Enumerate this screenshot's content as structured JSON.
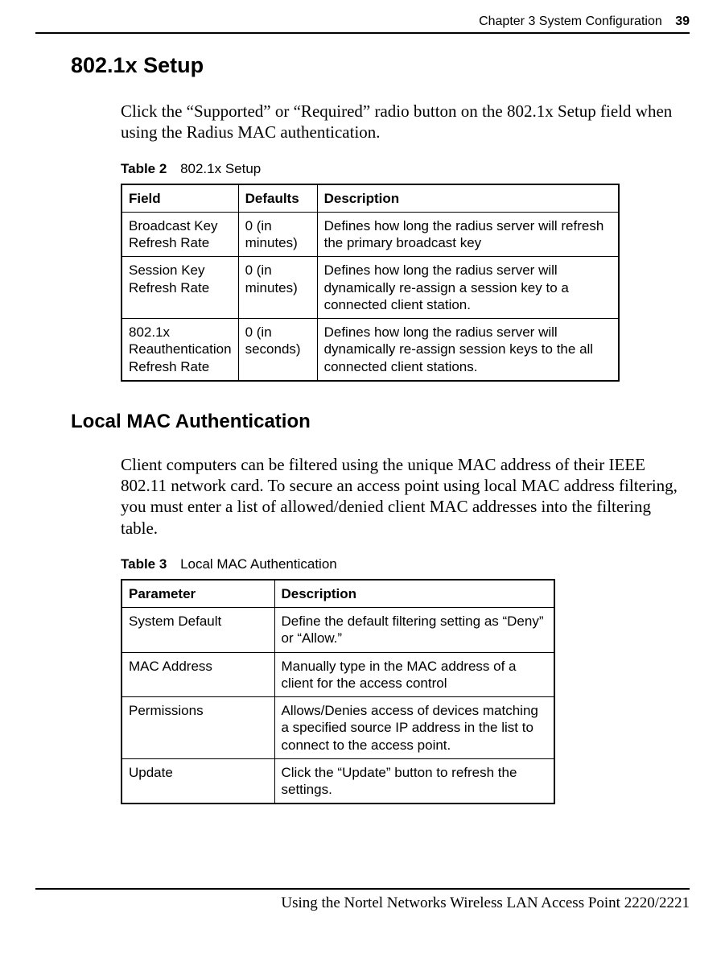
{
  "header": {
    "chapter": "Chapter 3  System Configuration",
    "pagenum": "39"
  },
  "section1": {
    "title": "802.1x Setup",
    "para": "Click the “Supported” or “Required” radio button on the 802.1x Setup field when using the Radius MAC authentication."
  },
  "table2": {
    "label": "Table 2",
    "title": "802.1x Setup",
    "headers": {
      "field": "Field",
      "defaults": "Defaults",
      "desc": "Description"
    },
    "rows": [
      {
        "field": "Broadcast Key Refresh Rate",
        "defaults": "0 (in minutes)",
        "desc": "Defines how long the radius server will refresh the primary broadcast key"
      },
      {
        "field": "Session Key Refresh Rate",
        "defaults": "0 (in minutes)",
        "desc": "Defines how long the radius server will dynamically re-assign a session key to a connected client station."
      },
      {
        "field": "802.1x Reauthentication Refresh Rate",
        "defaults": "0 (in seconds)",
        "desc": "Defines how long the radius server will dynamically re-assign session keys to the all connected client stations."
      }
    ]
  },
  "section2": {
    "title": "Local MAC Authentication",
    "para": "Client computers can be filtered using the unique MAC address of their IEEE 802.11 network card. To secure an access point using local MAC address filtering, you must enter a list of allowed/denied client MAC addresses into the filtering table."
  },
  "table3": {
    "label": "Table 3",
    "title": "Local MAC Authentication",
    "headers": {
      "param": "Parameter",
      "desc": "Description"
    },
    "rows": [
      {
        "param": "System Default",
        "desc": "Define the default filtering setting as “Deny” or “Allow.”"
      },
      {
        "param": "MAC Address",
        "desc": "Manually type in the MAC address of a client for the access control"
      },
      {
        "param": "Permissions",
        "desc": "Allows/Denies access of devices matching a specified source IP address in the list to connect to the access point."
      },
      {
        "param": "Update",
        "desc": "Click the “Update” button to refresh the settings."
      }
    ]
  },
  "footer": "Using the Nortel Networks Wireless LAN Access Point 2220/2221"
}
